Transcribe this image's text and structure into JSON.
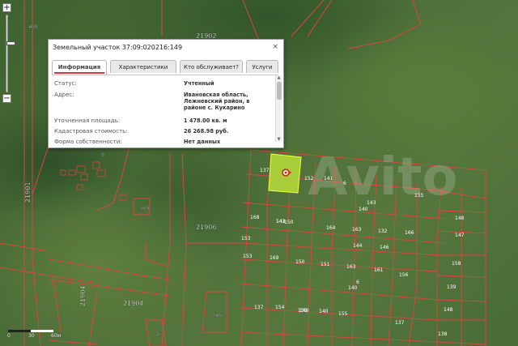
{
  "map": {
    "road_labels": [
      "21902",
      "21901",
      "21906",
      "21904",
      "21904"
    ],
    "block_number": "469",
    "small_labels": [
      "9",
      "163",
      "2",
      "145"
    ],
    "parcels": [
      "137",
      "152",
      "141",
      "6",
      "143",
      "142",
      "155",
      "168",
      "143",
      "150",
      "164",
      "163",
      "132",
      "166",
      "148",
      "153",
      "144",
      "140",
      "146",
      "147",
      "153",
      "169",
      "150",
      "151",
      "163",
      "161",
      "156",
      "158",
      "140",
      "6",
      "139",
      "137",
      "154",
      "133",
      "140",
      "155",
      "148",
      "137",
      "138",
      "149"
    ],
    "selected_parcel": "149"
  },
  "zoom": {
    "in_label": "+",
    "out_label": "−"
  },
  "popup": {
    "title": "Земельный участок 37:09:020216:149",
    "close_label": "×",
    "tabs": [
      {
        "label": "Информация",
        "active": true
      },
      {
        "label": "Характеристики",
        "active": false
      },
      {
        "label": "Кто обслуживает?",
        "active": false
      },
      {
        "label": "Услуги",
        "active": false
      }
    ],
    "rows": [
      {
        "label": "Статус:",
        "value": "Учтенный"
      },
      {
        "label": "Адрес:",
        "value": "Ивановская область, Лежневский район, в районе с. Кукарино"
      },
      {
        "label": "Уточненная площадь:",
        "value": "1 478.00 кв. м"
      },
      {
        "label": "Кадастровая стоимость:",
        "value": "26 268.98 руб."
      },
      {
        "label": "Форма собственности:",
        "value": "Нет данных"
      }
    ]
  },
  "scale": {
    "labels": [
      "0",
      "30",
      "60м"
    ]
  },
  "colors": {
    "parcel_line": "#d8473f",
    "selected_fill": "#b6dd3a",
    "road": "#c93a34",
    "tab_accent": "#d23a3a"
  }
}
